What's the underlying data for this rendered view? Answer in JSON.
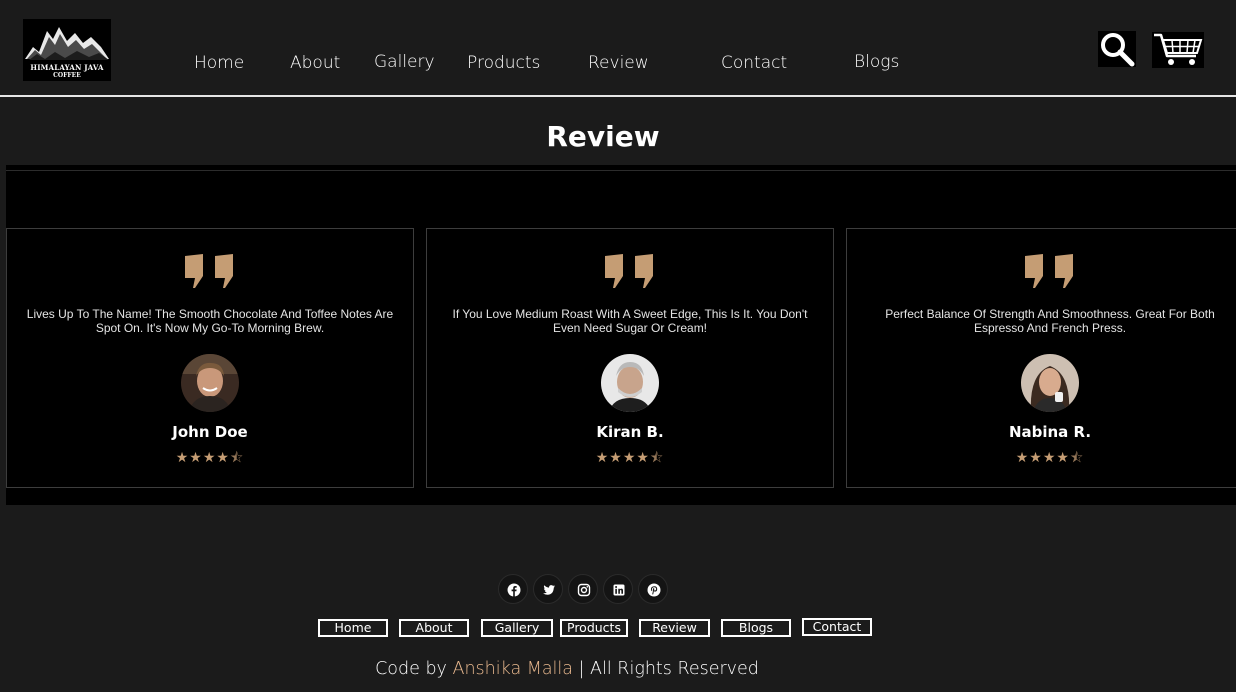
{
  "brand": {
    "line1": "HIMALAYAN JAVA",
    "line2": "COFFEE"
  },
  "nav": [
    "Home",
    "About",
    "Gallery",
    "Products",
    "Review",
    "Contact",
    "Blogs"
  ],
  "header_icons": [
    "search-icon",
    "cart-icon"
  ],
  "section_title": "Review",
  "reviews": [
    {
      "text": "Lives Up To The Name! The Smooth Chocolate And Toffee Notes Are Spot On. It's Now My Go-To Morning Brew.",
      "name": "John Doe",
      "rating": 4.5
    },
    {
      "text": "If You Love Medium Roast With A Sweet Edge, This Is It. You Don't Even Need Sugar Or Cream!",
      "name": "Kiran B.",
      "rating": 4.5
    },
    {
      "text": "Perfect Balance Of Strength And Smoothness. Great For Both Espresso And French Press.",
      "name": "Nabina R.",
      "rating": 4.5
    }
  ],
  "social_icons": [
    "facebook-icon",
    "twitter-icon",
    "instagram-icon",
    "linkedin-icon",
    "pinterest-icon"
  ],
  "footer_links": [
    "Home",
    "About",
    "Gallery",
    "Products",
    "Review",
    "Blogs",
    "Contact"
  ],
  "credits": {
    "prefix": "Code by ",
    "author": "Anshika Malla",
    "suffix": "| All Rights Reserved"
  },
  "colors": {
    "background": "#1b1b1b",
    "band": "#000000",
    "accent": "#c59d74",
    "author": "#e8b88e"
  }
}
